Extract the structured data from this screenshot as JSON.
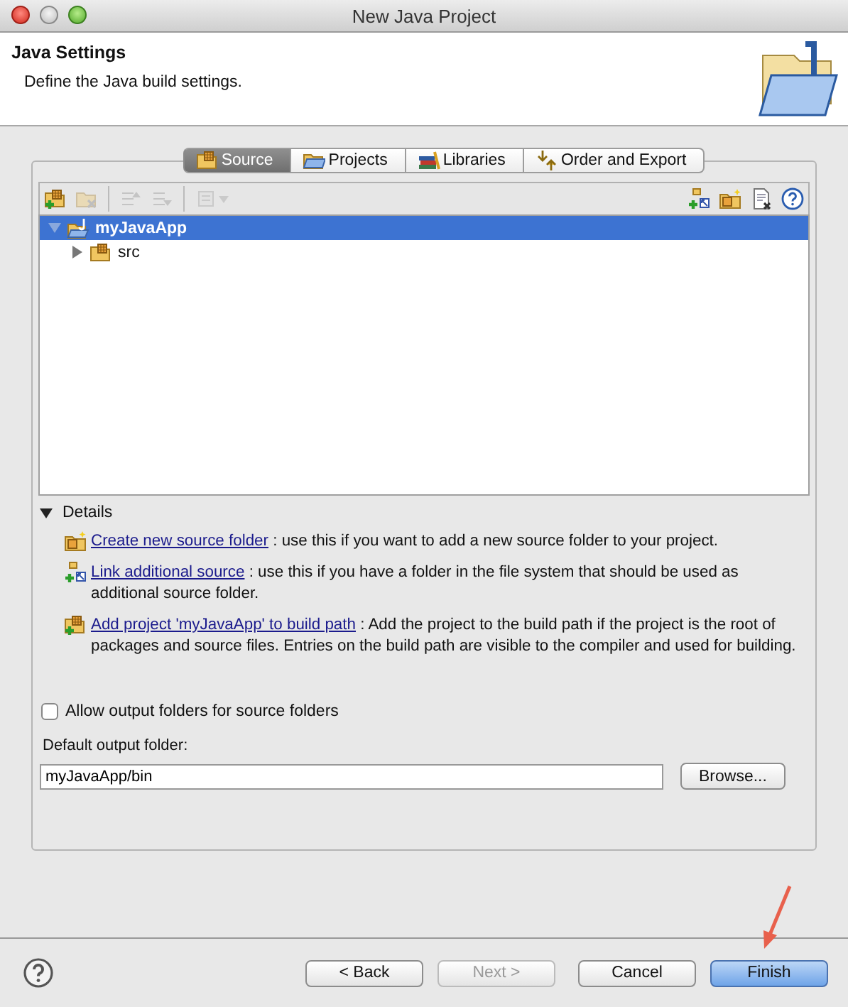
{
  "window": {
    "title": "New Java Project"
  },
  "header": {
    "title": "Java Settings",
    "description": "Define the Java build settings."
  },
  "tabs": [
    {
      "label": "Source",
      "selected": true,
      "kind": "source"
    },
    {
      "label": "Projects",
      "selected": false,
      "kind": "projects"
    },
    {
      "label": "Libraries",
      "selected": false,
      "kind": "libraries"
    },
    {
      "label": "Order and Export",
      "selected": false,
      "kind": "order"
    }
  ],
  "toolbar": {
    "left": [
      {
        "kind": "add-folder",
        "disabled": false
      },
      {
        "kind": "remove",
        "disabled": true
      },
      {
        "kind": "separator"
      },
      {
        "kind": "move-up",
        "disabled": true
      },
      {
        "kind": "move-down",
        "disabled": true
      },
      {
        "kind": "separator"
      },
      {
        "kind": "configure",
        "disabled": true
      }
    ],
    "right": [
      {
        "kind": "link-source",
        "disabled": false
      },
      {
        "kind": "new-folder",
        "disabled": false
      },
      {
        "kind": "remove-file",
        "disabled": false
      },
      {
        "kind": "help",
        "disabled": false
      }
    ]
  },
  "tree": [
    {
      "label": "myJavaApp",
      "kind": "project",
      "selected": true,
      "expanded": true,
      "children": [
        {
          "label": "src",
          "kind": "source-folder",
          "selected": false,
          "expanded": false
        }
      ]
    }
  ],
  "details": {
    "title": "Details",
    "expanded": true,
    "items": [
      {
        "kind": "new-folder",
        "link": "Create new source folder",
        "text": " : use this if you want to add a new source folder to your project."
      },
      {
        "kind": "link-source",
        "link": "Link additional source",
        "text": " : use this if you have a folder in the file system that should be used as additional source folder."
      },
      {
        "kind": "add-folder",
        "link": "Add project 'myJavaApp' to build path",
        "text": " : Add the project to the build path if the project is the root of packages and source files. Entries on the build path are visible to the compiler and used for building."
      }
    ]
  },
  "output_option": {
    "label": "Allow output folders for source folders",
    "checked": false
  },
  "output_folder": {
    "label": "Default output folder:",
    "value": "myJavaApp/bin",
    "button": "Browse..."
  },
  "footer": {
    "buttons": [
      {
        "label": "< Back",
        "disabled": false,
        "default": false
      },
      {
        "label": "Next >",
        "disabled": true,
        "default": false
      },
      {
        "label": "Cancel",
        "disabled": false,
        "default": false
      },
      {
        "label": "Finish",
        "disabled": false,
        "default": true
      }
    ]
  },
  "annotation": {
    "kind": "arrow"
  }
}
